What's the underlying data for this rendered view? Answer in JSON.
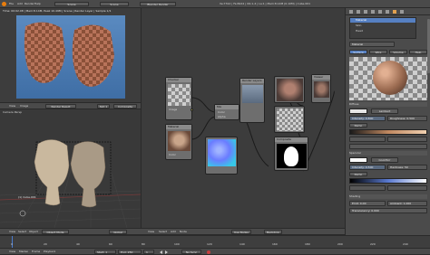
{
  "top_bar": {
    "menus": [
      "File",
      "Add",
      "Render",
      "Help"
    ],
    "render_engine": "Blender Render",
    "scene": "Scene",
    "stats": "Ve:7312 | Fa:6924 | Ob:1-4 | La:1 | Mem:8.14M (0.10M) | Cube.001"
  },
  "image_editor": {
    "header_text": "Time: 00:02.08 | Mem:8.14M, Peak 10.49M | Scene | Render Layer | Sample 1/1",
    "menus": [
      "View",
      "Image"
    ],
    "image_name": "Render Result",
    "slot": "Slot 1",
    "pass": "Composite"
  },
  "viewport": {
    "view_label": "Camera Persp",
    "object_label": "(1) Cube.001",
    "menus": [
      "View",
      "Select",
      "Object"
    ],
    "mode": "Object Mode",
    "orientation": "Global"
  },
  "node_editor": {
    "nodes": {
      "texture1": {
        "title": "Checker",
        "output": "Image"
      },
      "texture2": {
        "title": "Material",
        "output": "Color"
      },
      "mixrgb": {
        "title": "Mix",
        "socket1": "Color",
        "socket2": "Alpha"
      },
      "viewer": {
        "title": "Viewer"
      },
      "render_layers": {
        "title": "Render Layers"
      },
      "composite": {
        "title": "Composite"
      }
    },
    "menus": [
      "View",
      "Select",
      "Add",
      "Node"
    ],
    "use_nodes_label": "Use Nodes",
    "backdrop_label": "Backdrop"
  },
  "properties": {
    "tabs": [
      "Render",
      "Layers",
      "Scene",
      "World",
      "Object",
      "Modifiers",
      "Material",
      "Texture"
    ],
    "material_list": [
      "Material",
      "Skin",
      "Head"
    ],
    "material_name": "Material",
    "preview_tabs": [
      "Surface",
      "Wire",
      "Volume",
      "Halo"
    ],
    "diffuse": {
      "title": "Diffuse",
      "shader": "Lambert",
      "intensity_label": "Intensity: 0.800",
      "roughness_label": "Roughness: 0.500",
      "ramp_label": "Ramp"
    },
    "specular": {
      "title": "Specular",
      "shader": "CookTorr",
      "intensity_label": "Intensity: 0.500",
      "hardness_label": "Hardness: 50",
      "ramp_label": "Ramp"
    },
    "shading": {
      "title": "Shading",
      "emit": "Emit: 0.00",
      "ambient": "Ambient: 1.000",
      "translucency": "Translucency: 0.000"
    },
    "colors": {
      "diffuse": "#e6e6e6",
      "specular": "#ffffff",
      "accent": "#5680c2"
    }
  },
  "timeline": {
    "menus": [
      "View",
      "Marker",
      "Frame",
      "Playback"
    ],
    "start": "Start: 1",
    "end": "End: 250",
    "current": "1",
    "sync": "No Sync",
    "ticks": [
      "0",
      "20",
      "40",
      "60",
      "80",
      "100",
      "120",
      "140",
      "160",
      "180",
      "200",
      "220",
      "240"
    ]
  }
}
